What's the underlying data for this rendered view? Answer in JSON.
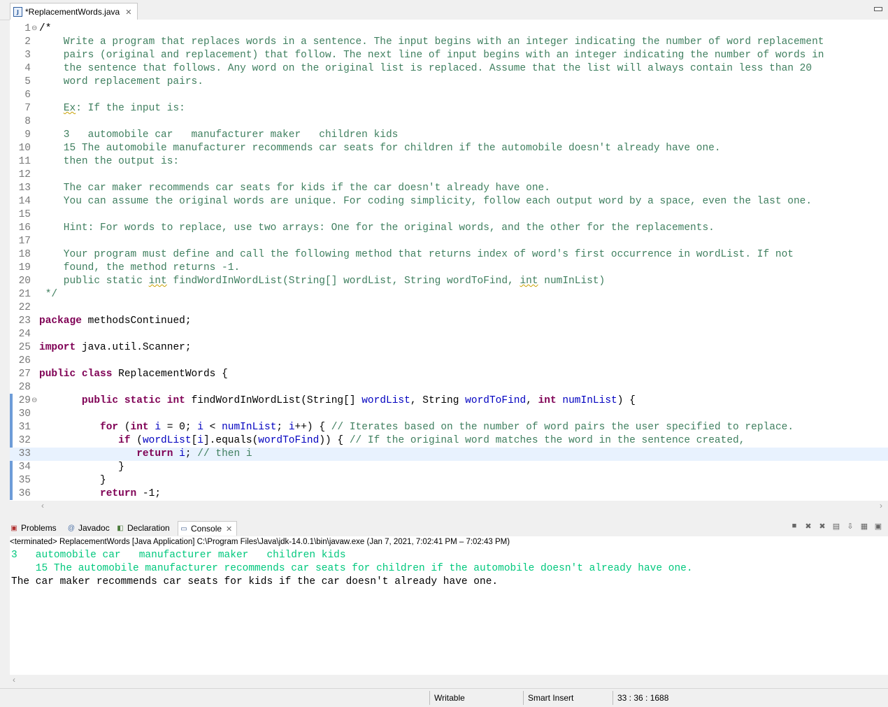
{
  "editor": {
    "tab_title": "*ReplacementWords.java",
    "lines": [
      [
        [
          "",
          "/*"
        ]
      ],
      [
        [
          "cm",
          "    Write a program that replaces words in a sentence. The input begins with an integer indicating the number of word replacement"
        ]
      ],
      [
        [
          "cm",
          "    pairs (original and replacement) that follow. The next line of input begins with an integer indicating the number of words in"
        ]
      ],
      [
        [
          "cm",
          "    the sentence that follows. Any word on the original list is replaced. Assume that the list will always contain less than 20"
        ]
      ],
      [
        [
          "cm",
          "    word replacement pairs."
        ]
      ],
      [],
      [
        [
          "cm",
          "    "
        ],
        [
          "cm squig",
          "Ex"
        ],
        [
          "cm",
          ": If the input is:"
        ]
      ],
      [],
      [
        [
          "cm",
          "    3   automobile car   manufacturer maker   children kids"
        ]
      ],
      [
        [
          "cm",
          "    15 The automobile manufacturer recommends car seats for children if the automobile doesn't already have one."
        ]
      ],
      [
        [
          "cm",
          "    then the output is:"
        ]
      ],
      [],
      [
        [
          "cm",
          "    The car maker recommends car seats for kids if the car doesn't already have one."
        ]
      ],
      [
        [
          "cm",
          "    You can assume the original words are unique. For coding simplicity, follow each output word by a space, even the last one."
        ]
      ],
      [],
      [
        [
          "cm",
          "    Hint: For words to replace, use two arrays: One for the original words, and the other for the replacements."
        ]
      ],
      [],
      [
        [
          "cm",
          "    Your program must define and call the following method that returns index of word's first occurrence in wordList. If not"
        ]
      ],
      [
        [
          "cm",
          "    found, the method returns -1."
        ]
      ],
      [
        [
          "cm",
          "    public static "
        ],
        [
          "cm squig",
          "int"
        ],
        [
          "cm",
          " findWordInWordList(String[] wordList, String wordToFind, "
        ],
        [
          "cm squig",
          "int"
        ],
        [
          "cm",
          " numInList)"
        ]
      ],
      [
        [
          "cm",
          " */"
        ]
      ],
      [],
      [
        [
          "kw",
          "package"
        ],
        [
          "",
          " methodsContinued;"
        ]
      ],
      [],
      [
        [
          "kw",
          "import"
        ],
        [
          "",
          " java.util.Scanner;"
        ]
      ],
      [],
      [
        [
          "kw",
          "public"
        ],
        [
          "",
          " "
        ],
        [
          "kw",
          "class"
        ],
        [
          "",
          " ReplacementWords {"
        ]
      ],
      [],
      [
        [
          "",
          "       "
        ],
        [
          "kw",
          "public"
        ],
        [
          "",
          " "
        ],
        [
          "kw",
          "static"
        ],
        [
          "",
          " "
        ],
        [
          "kw",
          "int"
        ],
        [
          "",
          " findWordInWordList(String[] "
        ],
        [
          "fld",
          "wordList"
        ],
        [
          "",
          ", String "
        ],
        [
          "fld",
          "wordToFind"
        ],
        [
          "",
          ", "
        ],
        [
          "kw",
          "int"
        ],
        [
          "",
          " "
        ],
        [
          "fld",
          "numInList"
        ],
        [
          "",
          ") {"
        ]
      ],
      [],
      [
        [
          "",
          "          "
        ],
        [
          "kw",
          "for"
        ],
        [
          "",
          " ("
        ],
        [
          "kw",
          "int"
        ],
        [
          "",
          " "
        ],
        [
          "fld",
          "i"
        ],
        [
          "",
          " = 0; "
        ],
        [
          "fld",
          "i"
        ],
        [
          "",
          " < "
        ],
        [
          "fld",
          "numInList"
        ],
        [
          "",
          "; "
        ],
        [
          "fld",
          "i"
        ],
        [
          "",
          "++) { "
        ],
        [
          "cm",
          "// Iterates based on the number of word pairs the user specified to replace."
        ]
      ],
      [
        [
          "",
          "             "
        ],
        [
          "kw",
          "if"
        ],
        [
          "",
          " ("
        ],
        [
          "fld",
          "wordList"
        ],
        [
          "",
          "["
        ],
        [
          "fld",
          "i"
        ],
        [
          "",
          "].equals("
        ],
        [
          "fld",
          "wordToFind"
        ],
        [
          "",
          ")) { "
        ],
        [
          "cm",
          "// If the original word matches the word in the sentence created,"
        ]
      ],
      [
        [
          "",
          "                "
        ],
        [
          "kw",
          "return"
        ],
        [
          "",
          " "
        ],
        [
          "fld",
          "i"
        ],
        [
          "",
          "; "
        ],
        [
          "cm",
          "// then i"
        ]
      ],
      [
        [
          "",
          "             }"
        ]
      ],
      [
        [
          "",
          "          }"
        ]
      ],
      [
        [
          "",
          "          "
        ],
        [
          "kw",
          "return"
        ],
        [
          "",
          " -1;"
        ]
      ]
    ]
  },
  "console": {
    "tabs": [
      {
        "name": "tab-problems",
        "label": "Problems",
        "icon": "problems-icon",
        "glyph": "▣"
      },
      {
        "name": "tab-javadoc",
        "label": "Javadoc",
        "icon": "javadoc-icon",
        "glyph": "@"
      },
      {
        "name": "tab-declaration",
        "label": "Declaration",
        "icon": "declaration-icon",
        "glyph": "◧"
      },
      {
        "name": "tab-console",
        "label": "Console",
        "icon": "console-icon",
        "glyph": "▭"
      }
    ],
    "header": "<terminated> ReplacementWords [Java Application] C:\\Program Files\\Java\\jdk-14.0.1\\bin\\javaw.exe  (Jan 7, 2021, 7:02:41 PM – 7:02:43 PM)",
    "input_line1": "3   automobile car   manufacturer maker   children kids",
    "input_line2": "    15 The automobile manufacturer recommends car seats for children if the automobile doesn't already have one.",
    "output_line": "The car maker recommends car seats for kids if the car doesn't already have one."
  },
  "status": {
    "writable": "Writable",
    "insert_mode": "Smart Insert",
    "position": "33 : 36 : 1688"
  },
  "colors": {
    "comment": "#3f7f5f",
    "keyword": "#7f0055",
    "field": "#0000c0",
    "console_input": "#00c87d"
  }
}
